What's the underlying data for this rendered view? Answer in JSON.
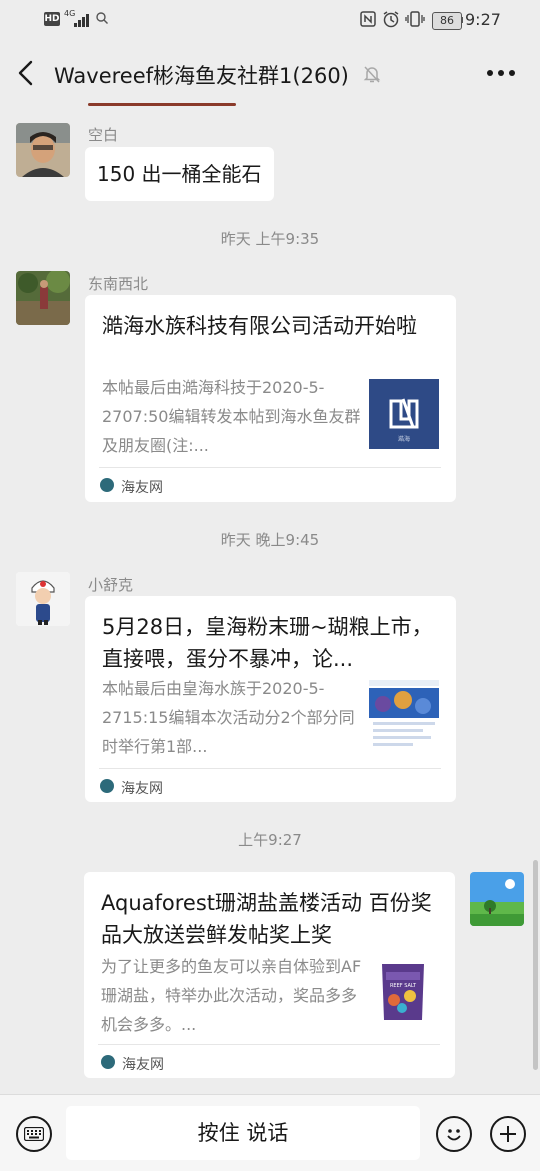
{
  "status_bar": {
    "network_badge": "HD",
    "network_type": "4G",
    "battery": "86",
    "time": "9:27"
  },
  "header": {
    "title": "Wavereef彬海鱼友社群1(260)",
    "back_icon": "chevron-left-icon",
    "mute_icon": "bell-off-icon",
    "more_icon": "more-horizontal-icon"
  },
  "messages": [
    {
      "sender": "空白",
      "text": "150 出一桶全能石"
    },
    {
      "timestamp": "昨天 上午9:35"
    },
    {
      "sender": "东南西北",
      "card": {
        "title": "澔海水族科技有限公司活动开始啦",
        "desc": "本帖最后由澔海科技于2020-5-2707:50编辑转发本帖到海水鱼友群及朋友圈(注:...",
        "source": "海友网",
        "thumb_text": "澔海"
      }
    },
    {
      "timestamp": "昨天 晚上9:45"
    },
    {
      "sender": "小舒克",
      "card": {
        "title": "5月28日，皇海粉末珊~瑚粮上市，直接喂，蛋分不暴冲，论...",
        "desc": "本帖最后由皇海水族于2020-5-2715:15编辑本次活动分2个部分同时举行第1部...",
        "source": "海友网"
      }
    },
    {
      "timestamp": "上午9:27"
    },
    {
      "self": true,
      "card": {
        "title": "Aquaforest珊湖盐盖楼活动 百份奖品大放送尝鲜发帖奖上奖",
        "desc": "为了让更多的鱼友可以亲自体验到AF珊湖盐，特举办此次活动，奖品多多机会多多。...",
        "source": "海友网",
        "thumb_text": "REEF SALT"
      }
    }
  ],
  "bottom_bar": {
    "voice_button_label": "按住 说话",
    "keyboard_icon": "keyboard-icon",
    "emoji_icon": "emoji-icon",
    "plus_icon": "plus-circle-icon"
  },
  "colors": {
    "background": "#ededed",
    "bubble": "#ffffff",
    "muted_text": "#8a8a8a"
  }
}
